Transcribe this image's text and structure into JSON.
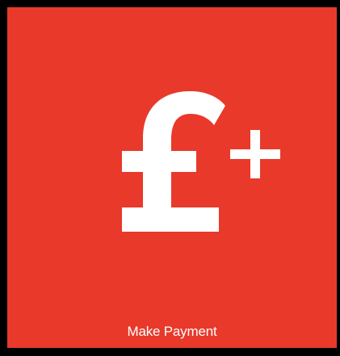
{
  "tile": {
    "label": "Make Payment",
    "icon": "pound-plus-icon",
    "background_color": "#e8392b",
    "foreground_color": "#ffffff"
  }
}
